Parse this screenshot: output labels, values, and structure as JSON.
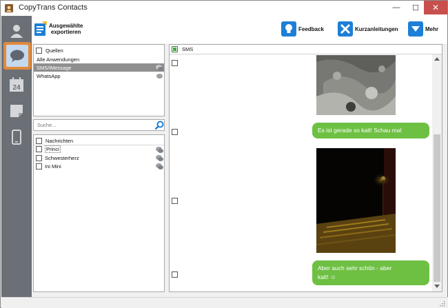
{
  "window": {
    "title": "CopyTrans Contacts",
    "minimize": "—",
    "maximize": "☐",
    "close": "✕"
  },
  "toolbar": {
    "export_line1": "Ausgewählte",
    "export_line2": "exportieren",
    "feedback": "Feedback",
    "guides": "Kurzanleitungen",
    "more": "Mehr"
  },
  "sources": {
    "header": "Quellen",
    "items": [
      "Alle Anwendungen",
      "SMS/iMessage",
      "WhatsApp"
    ],
    "selected_index": 1
  },
  "search": {
    "placeholder": "Suche..."
  },
  "conversations": {
    "header": "Nachrichten",
    "items": [
      "Princi",
      "Schwesterherz",
      "Ini Mini"
    ]
  },
  "messages": {
    "header": "SMS",
    "bubble1": "Es ist gerade so kalt! Schau mal",
    "bubble2_line1": "Aber auch sehr schön - aber",
    "bubble2_line2": "kalt! ☺"
  },
  "colors": {
    "accent_orange": "#e08a3a",
    "bubble_green": "#6ec043",
    "toolbar_blue": "#1d7fd6",
    "sidebar_gray": "#6b6f76",
    "selection_gray": "#8f8f8f"
  }
}
